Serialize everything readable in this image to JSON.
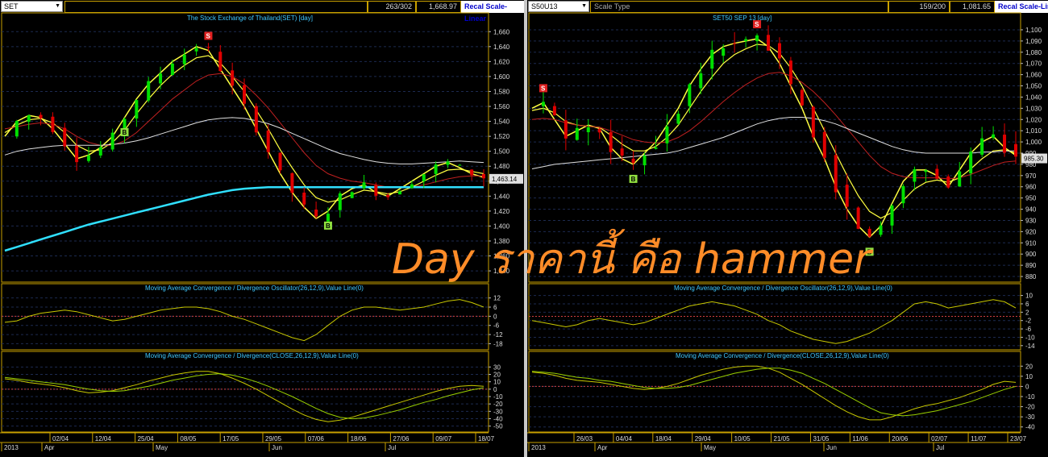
{
  "left": {
    "symbol": "SET",
    "header_count": "263/302",
    "header_price": "1,668.97",
    "recal_button": "Recal Scale-Linear",
    "title": "The Stock Exchange of Thailand(SET) [day]",
    "price_tag": "1,463.14",
    "buy_signal_label": "B",
    "sell_signal_label": "S",
    "macd_osc_title": "Moving Average Convergence / Divergence Oscillator(26,12,9),Value Line(0)",
    "macd_title": "Moving Average Convergence / Divergence(CLOSE,26,12,9),Value Line(0)"
  },
  "right": {
    "symbol": "S50U13",
    "scale_type": "Scale Type",
    "header_count": "159/200",
    "header_price": "1,081.65",
    "recal_button": "Recal Scale-Line",
    "title": "SET50 SEP 13    [day]",
    "price_tag": "985.30",
    "buy_signal_label": "B",
    "sell_signal_label": "S",
    "macd_osc_title": "Moving Average Convergence / Divergence Oscillator(26,12,9),Value Line(0)",
    "macd_title": "Moving Average Convergence / Divergence(CLOSE,26,12,9),Value Line(0)"
  },
  "watermark": "Day ราคานี้ คือ hammer",
  "colors": {
    "up": "#00e000",
    "down": "#e00000",
    "ema_fast": "#ffff40",
    "ema_mid": "#c02020",
    "ema_slow": "#e0e0e0",
    "ema_long": "#30e0ff",
    "signal_line": "#c8c800",
    "panel_border": "#c8a000"
  },
  "chart_data": [
    {
      "type": "line",
      "title": "The Stock Exchange of Thailand(SET) [day]",
      "note": "candlestick price chart with moving averages",
      "x_ticks": [
        "02/04",
        "12/04",
        "25/04",
        "08/05",
        "17/05",
        "29/05",
        "07/06",
        "18/06",
        "27/06",
        "09/07",
        "18/07"
      ],
      "month_labels": [
        "2013",
        "Apr",
        "May",
        "Jun",
        "Jul"
      ],
      "y_ticks": [
        1660,
        1640,
        1620,
        1600,
        1580,
        1560,
        1540,
        1520,
        1500,
        1480,
        1460,
        1440,
        1420,
        1400,
        1380,
        1360,
        1340
      ],
      "ylim": [
        1325,
        1670
      ],
      "last_price": 1463.14,
      "series": [
        {
          "values": [
            1520,
            1540,
            1548,
            1545,
            1530,
            1510,
            1490,
            1495,
            1505,
            1520,
            1545,
            1570,
            1590,
            1605,
            1620,
            1630,
            1640,
            1635,
            1610,
            1585,
            1560,
            1530,
            1500,
            1470,
            1445,
            1425,
            1410,
            1420,
            1440,
            1450,
            1455,
            1445,
            1440,
            1450,
            1460,
            1470,
            1480,
            1485,
            1478,
            1470,
            1465
          ]
        },
        {
          "values": [
            1525,
            1535,
            1542,
            1544,
            1538,
            1525,
            1508,
            1500,
            1502,
            1512,
            1528,
            1550,
            1570,
            1588,
            1603,
            1615,
            1625,
            1628,
            1618,
            1600,
            1580,
            1555,
            1530,
            1502,
            1478,
            1455,
            1438,
            1432,
            1435,
            1442,
            1448,
            1446,
            1443,
            1446,
            1452,
            1460,
            1468,
            1475,
            1476,
            1473,
            1470
          ]
        },
        {
          "values": [
            1530,
            1533,
            1536,
            1538,
            1536,
            1530,
            1520,
            1512,
            1508,
            1508,
            1514,
            1525,
            1540,
            1555,
            1570,
            1582,
            1594,
            1602,
            1604,
            1600,
            1590,
            1575,
            1558,
            1538,
            1518,
            1498,
            1481,
            1470,
            1464,
            1460,
            1458,
            1455,
            1452,
            1451,
            1452,
            1455,
            1459,
            1463,
            1466,
            1467,
            1467
          ]
        },
        {
          "values": [
            1495,
            1500,
            1503,
            1505,
            1507,
            1508,
            1508,
            1508,
            1508,
            1509,
            1511,
            1514,
            1518,
            1523,
            1528,
            1533,
            1538,
            1542,
            1544,
            1545,
            1544,
            1541,
            1537,
            1531,
            1524,
            1517,
            1510,
            1503,
            1497,
            1493,
            1489,
            1486,
            1484,
            1483,
            1483,
            1484,
            1485,
            1486,
            1487,
            1486,
            1485
          ]
        },
        {
          "values": [
            1367,
            1372,
            1377,
            1382,
            1387,
            1392,
            1397,
            1402,
            1406,
            1410,
            1414,
            1418,
            1422,
            1426,
            1430,
            1434,
            1438,
            1442,
            1445,
            1448,
            1450,
            1451,
            1452,
            1452,
            1452,
            1452,
            1452,
            1452,
            1452,
            1452,
            1452,
            1452,
            1452,
            1452,
            1452,
            1452,
            1452,
            1452,
            1452,
            1452,
            1452
          ]
        }
      ]
    },
    {
      "type": "line",
      "title": "Moving Average Convergence / Divergence Oscillator(26,12,9),Value Line(0)",
      "y_ticks": [
        12,
        6,
        0,
        -6,
        -12,
        -18
      ],
      "ylim": [
        -22,
        15
      ],
      "series": [
        {
          "values": [
            -4,
            -3,
            0,
            2,
            3,
            4,
            3,
            1,
            -1,
            -3,
            -2,
            0,
            2,
            4,
            5,
            6,
            6,
            5,
            3,
            0,
            -2,
            -5,
            -8,
            -11,
            -14,
            -16,
            -12,
            -6,
            0,
            4,
            6,
            6,
            5,
            4,
            5,
            6,
            8,
            10,
            11,
            9,
            6
          ]
        }
      ]
    },
    {
      "type": "line",
      "title": "Moving Average Convergence / Divergence(CLOSE,26,12,9),Value Line(0)",
      "y_ticks": [
        30,
        20,
        10,
        0,
        -10,
        -20,
        -30,
        -40,
        -50
      ],
      "ylim": [
        -58,
        38
      ],
      "series": [
        {
          "values": [
            14,
            12,
            9,
            7,
            5,
            2,
            -2,
            -5,
            -4,
            -2,
            2,
            6,
            11,
            15,
            19,
            22,
            24,
            24,
            21,
            15,
            8,
            0,
            -9,
            -18,
            -27,
            -35,
            -41,
            -44,
            -42,
            -38,
            -33,
            -28,
            -23,
            -18,
            -13,
            -8,
            -3,
            1,
            4,
            5,
            4
          ]
        },
        {
          "values": [
            16,
            14,
            12,
            10,
            8,
            6,
            3,
            0,
            -2,
            -3,
            -2,
            1,
            4,
            8,
            12,
            15,
            18,
            20,
            21,
            19,
            15,
            10,
            4,
            -3,
            -10,
            -18,
            -26,
            -33,
            -38,
            -40,
            -39,
            -36,
            -32,
            -28,
            -23,
            -18,
            -14,
            -9,
            -5,
            -1,
            2
          ]
        }
      ]
    },
    {
      "type": "line",
      "title": "SET50 SEP 13    [day]",
      "note": "candlestick price chart with moving averages",
      "x_ticks": [
        "26/03",
        "04/04",
        "18/04",
        "29/04",
        "10/05",
        "21/05",
        "31/05",
        "11/06",
        "20/06",
        "02/07",
        "11/07",
        "23/07"
      ],
      "month_labels": [
        "2013",
        "Apr",
        "May",
        "Jun",
        "Jul"
      ],
      "y_ticks": [
        1100,
        1090,
        1080,
        1070,
        1060,
        1050,
        1040,
        1030,
        1020,
        1010,
        1000,
        990,
        980,
        970,
        960,
        950,
        940,
        930,
        920,
        910,
        900,
        890,
        880
      ],
      "ylim": [
        875,
        1105
      ],
      "last_price": 985.3,
      "series": [
        {
          "values": [
            1030,
            1035,
            1020,
            1005,
            1010,
            1015,
            1012,
            995,
            985,
            980,
            990,
            1000,
            1015,
            1030,
            1050,
            1065,
            1078,
            1085,
            1088,
            1090,
            1092,
            1085,
            1070,
            1050,
            1030,
            1005,
            985,
            960,
            940,
            925,
            915,
            925,
            945,
            965,
            975,
            975,
            970,
            960,
            975,
            990,
            1000,
            1005,
            995,
            988
          ]
        },
        {
          "values": [
            1028,
            1030,
            1026,
            1018,
            1015,
            1014,
            1013,
            1006,
            998,
            992,
            992,
            996,
            1004,
            1015,
            1030,
            1045,
            1058,
            1070,
            1078,
            1083,
            1087,
            1086,
            1079,
            1066,
            1050,
            1030,
            1010,
            990,
            970,
            952,
            938,
            932,
            937,
            948,
            958,
            964,
            966,
            964,
            968,
            976,
            985,
            992,
            993,
            990
          ]
        },
        {
          "values": [
            1020,
            1021,
            1020,
            1017,
            1015,
            1014,
            1013,
            1010,
            1006,
            1002,
            1000,
            999,
            1000,
            1004,
            1010,
            1018,
            1027,
            1036,
            1044,
            1051,
            1057,
            1061,
            1062,
            1059,
            1053,
            1045,
            1035,
            1024,
            1012,
            1000,
            988,
            978,
            972,
            969,
            968,
            968,
            968,
            967,
            968,
            971,
            975,
            979,
            982,
            983
          ]
        },
        {
          "values": [
            976,
            978,
            980,
            981,
            982,
            983,
            984,
            985,
            986,
            987,
            988,
            989,
            990,
            992,
            995,
            998,
            1001,
            1004,
            1008,
            1012,
            1016,
            1019,
            1021,
            1022,
            1022,
            1021,
            1019,
            1016,
            1012,
            1008,
            1004,
            1000,
            996,
            993,
            991,
            990,
            990,
            990,
            990,
            990,
            991,
            991,
            992,
            992
          ]
        }
      ]
    },
    {
      "type": "line",
      "title": "Moving Average Convergence / Divergence Oscillator(26,12,9),Value Line(0)",
      "y_ticks": [
        10,
        6,
        2,
        -2,
        -6,
        -10,
        -14
      ],
      "ylim": [
        -16,
        11
      ],
      "series": [
        {
          "values": [
            -2,
            -3,
            -4,
            -5,
            -4,
            -2,
            -1,
            -2,
            -3,
            -4,
            -3,
            -1,
            1,
            3,
            5,
            6,
            7,
            6,
            5,
            3,
            1,
            -2,
            -4,
            -7,
            -9,
            -11,
            -12,
            -13,
            -12,
            -10,
            -8,
            -5,
            -2,
            2,
            6,
            7,
            6,
            4,
            5,
            6,
            7,
            8,
            7,
            4
          ]
        }
      ]
    },
    {
      "type": "line",
      "title": "Moving Average Convergence / Divergence(CLOSE,26,12,9),Value Line(0)",
      "y_ticks": [
        20,
        10,
        0,
        -10,
        -20,
        -30,
        -40
      ],
      "ylim": [
        -45,
        25
      ],
      "series": [
        {
          "values": [
            14,
            13,
            11,
            8,
            6,
            5,
            4,
            2,
            0,
            -2,
            -3,
            -2,
            0,
            3,
            7,
            11,
            14,
            17,
            19,
            20,
            20,
            18,
            14,
            8,
            2,
            -5,
            -12,
            -19,
            -25,
            -30,
            -33,
            -33,
            -30,
            -26,
            -22,
            -19,
            -17,
            -14,
            -11,
            -7,
            -3,
            2,
            5,
            4
          ]
        },
        {
          "values": [
            15,
            14,
            13,
            11,
            9,
            8,
            6,
            5,
            3,
            1,
            -1,
            -2,
            -2,
            -1,
            1,
            4,
            7,
            10,
            13,
            15,
            17,
            18,
            18,
            16,
            13,
            8,
            3,
            -3,
            -9,
            -15,
            -21,
            -26,
            -28,
            -29,
            -28,
            -26,
            -24,
            -21,
            -18,
            -15,
            -11,
            -7,
            -3,
            0
          ]
        }
      ]
    }
  ]
}
